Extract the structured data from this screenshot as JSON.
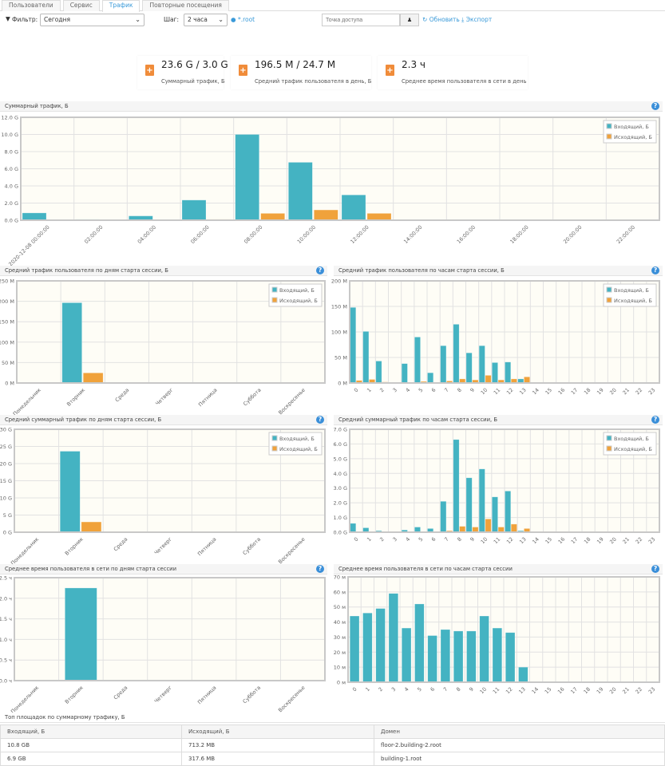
{
  "tabs": [
    "Пользователи",
    "Сервис",
    "Трафик",
    "Повторные посещения"
  ],
  "active_tab": "Трафик",
  "toolbar": {
    "filter_label": "Фильтр:",
    "filter_value": "Сегодня",
    "step_label": "Шаг:",
    "step_value": "2 часа",
    "domain_link": "*.root",
    "access_point_placeholder": "Точка доступа",
    "refresh_label": "Обновить",
    "export_label": "Экспорт"
  },
  "stats": [
    {
      "value": "23.6 G / 3.0 G",
      "label": "Суммарный трафик, Б"
    },
    {
      "value": "196.5 M / 24.7 M",
      "label": "Средний трафик пользователя в день, Б"
    },
    {
      "value": "2.3 ч",
      "label": "Среднее время пользователя в сети в день"
    }
  ],
  "colors": {
    "incoming": "#44b3c2",
    "outgoing": "#f0a23b",
    "accent": "#3a9ad9",
    "stat_icon": "#f08c3a"
  },
  "legend": {
    "incoming": "Входящий, Б",
    "outgoing": "Исходящий, Б"
  },
  "chart_data": [
    {
      "id": "c1",
      "title": "Суммарный трафик, Б",
      "type": "bar",
      "categories": [
        "2020-12-08 00:00:00",
        "02:00:00",
        "04:00:00",
        "06:00:00",
        "08:00:00",
        "10:00:00",
        "12:00:00",
        "14:00:00",
        "16:00:00",
        "18:00:00",
        "20:00:00",
        "22:00:00"
      ],
      "ylim": [
        0,
        12
      ],
      "yticks": [
        "0.0 G",
        "2.0 G",
        "4.0 G",
        "6.0 G",
        "8.0 G",
        "10.0 G",
        "12.0 G"
      ],
      "legend": "top-right",
      "grid": true,
      "series": [
        {
          "name": "Входящий, Б",
          "values": [
            0.85,
            0.1,
            0.5,
            2.35,
            10.0,
            6.75,
            2.95,
            0,
            0,
            0,
            0,
            0
          ]
        },
        {
          "name": "Исходящий, Б",
          "values": [
            0.05,
            0.02,
            0.02,
            0.1,
            0.8,
            1.2,
            0.8,
            0,
            0,
            0,
            0,
            0
          ]
        }
      ]
    },
    {
      "id": "c2",
      "title": "Средний трафик пользователя по дням старта сессии, Б",
      "type": "bar",
      "categories": [
        "Понедельник",
        "Вторник",
        "Среда",
        "Четверг",
        "Пятница",
        "Суббота",
        "Воскресенье"
      ],
      "ylim": [
        0,
        250
      ],
      "yticks": [
        "0 M",
        "50 M",
        "100 M",
        "150 M",
        "200 M",
        "250 M"
      ],
      "legend": "top-right",
      "grid": true,
      "series": [
        {
          "name": "Входящий, Б",
          "values": [
            0,
            196.5,
            0,
            0,
            0,
            0,
            0
          ]
        },
        {
          "name": "Исходящий, Б",
          "values": [
            0,
            24.7,
            0,
            0,
            0,
            0,
            0
          ]
        }
      ]
    },
    {
      "id": "c3",
      "title": "Средний трафик пользователя по часам старта сессии, Б",
      "type": "bar",
      "categories": [
        "0",
        "1",
        "2",
        "3",
        "4",
        "5",
        "6",
        "7",
        "8",
        "9",
        "10",
        "11",
        "12",
        "13",
        "14",
        "15",
        "16",
        "17",
        "18",
        "19",
        "20",
        "21",
        "22",
        "23"
      ],
      "ylim": [
        0,
        200
      ],
      "yticks": [
        "0 M",
        "50 M",
        "100 M",
        "150 M",
        "200 M"
      ],
      "legend": "top-right",
      "grid": true,
      "series": [
        {
          "name": "Входящий, Б",
          "values": [
            148,
            101,
            43,
            0,
            38,
            90,
            20,
            73,
            115,
            59,
            73,
            40,
            41,
            8,
            0,
            0,
            0,
            0,
            0,
            0,
            0,
            0,
            0,
            0
          ]
        },
        {
          "name": "Исходящий, Б",
          "values": [
            5,
            7,
            2,
            0,
            1,
            3,
            1,
            4,
            8,
            6,
            15,
            6,
            8,
            12,
            0,
            0,
            0,
            0,
            0,
            0,
            0,
            0,
            0,
            0
          ]
        }
      ]
    },
    {
      "id": "c4",
      "title": "Средний суммарный трафик по дням старта сессии, Б",
      "type": "bar",
      "categories": [
        "Понедельник",
        "Вторник",
        "Среда",
        "Четверг",
        "Пятница",
        "Суббота",
        "Воскресенье"
      ],
      "ylim": [
        0,
        30
      ],
      "yticks": [
        "0 G",
        "5 G",
        "10 G",
        "15 G",
        "20 G",
        "25 G",
        "30 G"
      ],
      "legend": "top-right",
      "grid": true,
      "series": [
        {
          "name": "Входящий, Б",
          "values": [
            0,
            23.6,
            0,
            0,
            0,
            0,
            0
          ]
        },
        {
          "name": "Исходящий, Б",
          "values": [
            0,
            3.0,
            0,
            0,
            0,
            0,
            0
          ]
        }
      ]
    },
    {
      "id": "c5",
      "title": "Средний суммарный трафик по часам старта сессии, Б",
      "type": "bar",
      "categories": [
        "0",
        "1",
        "2",
        "3",
        "4",
        "5",
        "6",
        "7",
        "8",
        "9",
        "10",
        "11",
        "12",
        "13",
        "14",
        "15",
        "16",
        "17",
        "18",
        "19",
        "20",
        "21",
        "22",
        "23"
      ],
      "ylim": [
        0,
        7
      ],
      "yticks": [
        "0.0 G",
        "1.0 G",
        "2.0 G",
        "3.0 G",
        "4.0 G",
        "5.0 G",
        "6.0 G",
        "7.0 G"
      ],
      "legend": "top-right",
      "grid": true,
      "series": [
        {
          "name": "Входящий, Б",
          "values": [
            0.6,
            0.3,
            0.1,
            0,
            0.15,
            0.35,
            0.25,
            2.1,
            6.3,
            3.7,
            4.3,
            2.4,
            2.8,
            0.1,
            0,
            0,
            0,
            0,
            0,
            0,
            0,
            0,
            0,
            0
          ]
        },
        {
          "name": "Исходящий, Б",
          "values": [
            0.02,
            0.02,
            0.01,
            0,
            0.02,
            0.05,
            0.02,
            0.1,
            0.4,
            0.35,
            0.9,
            0.35,
            0.55,
            0.25,
            0,
            0,
            0,
            0,
            0,
            0,
            0,
            0,
            0,
            0
          ]
        }
      ]
    },
    {
      "id": "c6",
      "title": "Среднее время пользователя в сети по дням старта сессии",
      "type": "bar",
      "categories": [
        "Понедельник",
        "Вторник",
        "Среда",
        "Четверг",
        "Пятница",
        "Суббота",
        "Воскресенье"
      ],
      "ylim": [
        0,
        2.5
      ],
      "yticks": [
        "0.0 ч",
        "0.5 ч",
        "1.0 ч",
        "1.5 ч",
        "2.0 ч",
        "2.5 ч"
      ],
      "grid": true,
      "series": [
        {
          "values": [
            0,
            2.25,
            0,
            0,
            0,
            0,
            0
          ]
        }
      ]
    },
    {
      "id": "c7",
      "title": "Среднее время пользователя в сети по часам старта сессии",
      "type": "bar",
      "categories": [
        "0",
        "1",
        "2",
        "3",
        "4",
        "5",
        "6",
        "7",
        "8",
        "9",
        "10",
        "11",
        "12",
        "13",
        "14",
        "15",
        "16",
        "17",
        "18",
        "19",
        "20",
        "21",
        "22",
        "23"
      ],
      "ylim": [
        0,
        70
      ],
      "yticks": [
        "0 м",
        "10 м",
        "20 м",
        "30 м",
        "40 м",
        "50 м",
        "60 м",
        "70 м"
      ],
      "grid": true,
      "series": [
        {
          "values": [
            44,
            46,
            49,
            59,
            36,
            52,
            31,
            35,
            34,
            34,
            44,
            36,
            33,
            10,
            0,
            0,
            0,
            0,
            0,
            0,
            0,
            0,
            0,
            0
          ]
        }
      ]
    }
  ],
  "top_table": {
    "title": "Топ площадок по суммарному трафику, Б",
    "columns": [
      "Входящий, Б",
      "Исходящий, Б",
      "Домен"
    ],
    "rows": [
      [
        "10.8 GB",
        "713.2 MB",
        "floor-2.building-2.root"
      ],
      [
        "6.9 GB",
        "317.6 MB",
        "building-1.root"
      ]
    ]
  }
}
